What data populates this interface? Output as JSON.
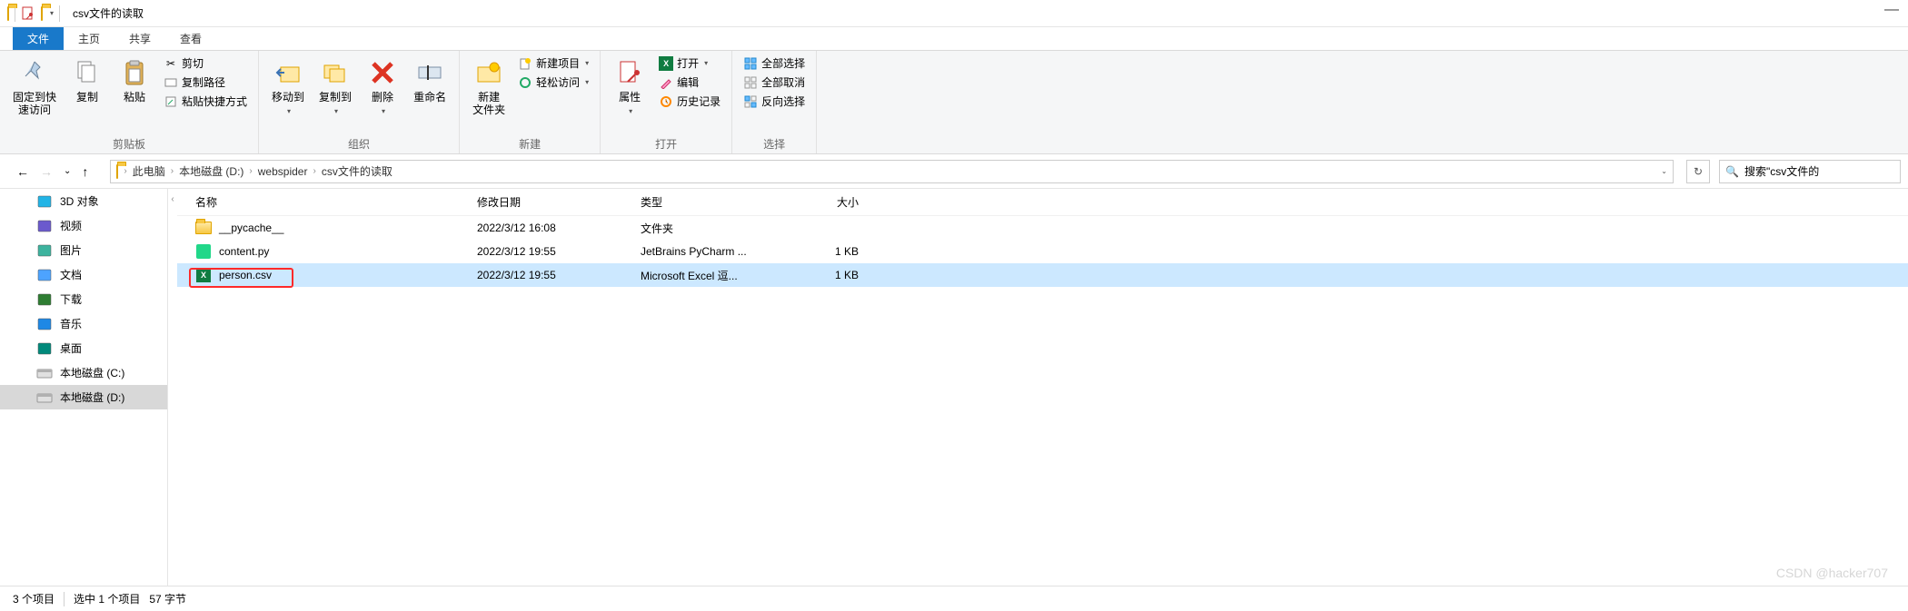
{
  "title": "csv文件的读取",
  "tabs": {
    "file": "文件",
    "home": "主页",
    "share": "共享",
    "view": "查看"
  },
  "ribbon": {
    "clipboard": {
      "pin": "固定到快\n速访问",
      "copy": "复制",
      "paste": "粘贴",
      "cut": "剪切",
      "copypath": "复制路径",
      "shortcut": "粘贴快捷方式",
      "label": "剪贴板"
    },
    "organize": {
      "moveto": "移动到",
      "copyto": "复制到",
      "delete": "删除",
      "rename": "重命名",
      "label": "组织"
    },
    "new": {
      "newfolder": "新建\n文件夹",
      "newitem": "新建项目",
      "easyaccess": "轻松访问",
      "label": "新建"
    },
    "open": {
      "props": "属性",
      "open": "打开",
      "edit": "编辑",
      "history": "历史记录",
      "label": "打开"
    },
    "select": {
      "all": "全部选择",
      "none": "全部取消",
      "invert": "反向选择",
      "label": "选择"
    }
  },
  "breadcrumb": [
    "此电脑",
    "本地磁盘 (D:)",
    "webspider",
    "csv文件的读取"
  ],
  "search_placeholder": "搜索\"csv文件的",
  "sidebar": [
    {
      "label": "3D 对象",
      "color": "#22b4e6"
    },
    {
      "label": "视频",
      "color": "#6b5acd"
    },
    {
      "label": "图片",
      "color": "#3db39e"
    },
    {
      "label": "文档",
      "color": "#4da3ff"
    },
    {
      "label": "下载",
      "color": "#2e7d32"
    },
    {
      "label": "音乐",
      "color": "#1e88e5"
    },
    {
      "label": "桌面",
      "color": "#00897b"
    },
    {
      "label": "本地磁盘 (C:)",
      "color": "#9e9e9e"
    },
    {
      "label": "本地磁盘 (D:)",
      "color": "#9e9e9e"
    }
  ],
  "columns": {
    "name": "名称",
    "date": "修改日期",
    "type": "类型",
    "size": "大小"
  },
  "files": [
    {
      "icon": "folder",
      "name": "__pycache__",
      "date": "2022/3/12 16:08",
      "type": "文件夹",
      "size": ""
    },
    {
      "icon": "py",
      "name": "content.py",
      "date": "2022/3/12 19:55",
      "type": "JetBrains PyCharm ...",
      "size": "1 KB"
    },
    {
      "icon": "excel",
      "name": "person.csv",
      "date": "2022/3/12 19:55",
      "type": "Microsoft Excel 逗...",
      "size": "1 KB",
      "selected": true,
      "highlight": true
    }
  ],
  "status": {
    "count": "3 个项目",
    "selected": "选中 1 个项目",
    "bytes": "57 字节"
  },
  "watermark": "CSDN @hacker707"
}
